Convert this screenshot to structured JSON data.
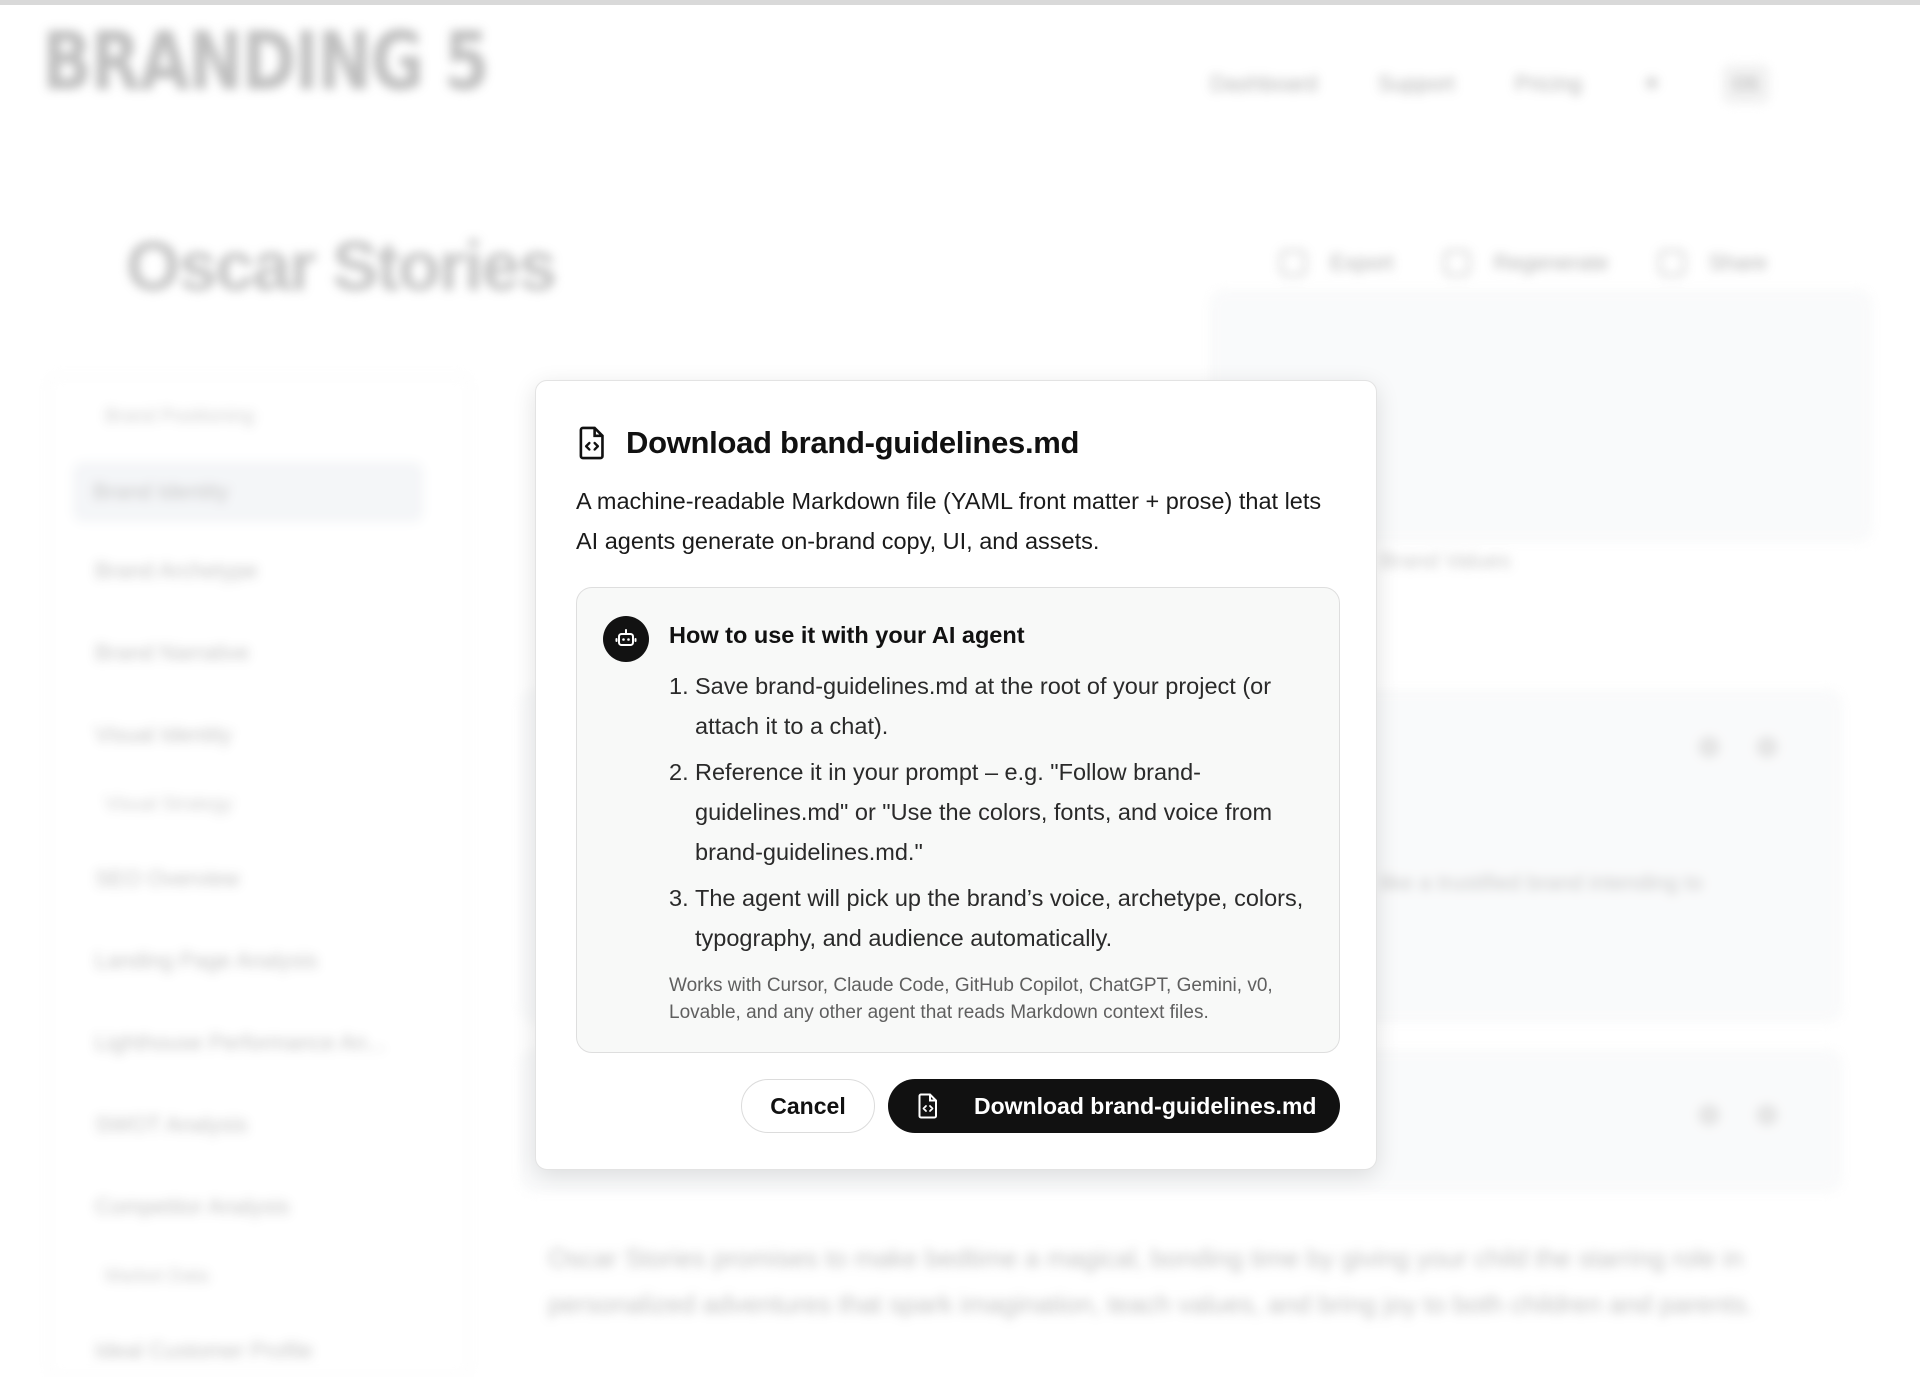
{
  "app": {
    "logo_text": "BRANDING 5",
    "nav": [
      "Dashboard",
      "Support",
      "Pricing"
    ],
    "theme_toggle_icon": "sun-icon",
    "profile_label": "OS"
  },
  "page": {
    "title": "Oscar Stories",
    "actions": [
      "Export",
      "Regenerate",
      "Share"
    ]
  },
  "sidebar": {
    "group_1": "Brand Positioning",
    "items_1": [
      "Brand Identity",
      "Brand Archetype",
      "Brand Narrative",
      "Visual Identity"
    ],
    "group_2": "Visual Strategy",
    "items_2": [
      "SEO Overview",
      "Landing Page Analysis",
      "Lighthouse Performance An...",
      "SWOT Analysis",
      "Competitor Analysis"
    ],
    "group_3": "Market Data",
    "items_3": [
      "Ideal Customer Profile"
    ]
  },
  "background_content": {
    "card_text_1": "Brand Values",
    "card_text_2": "like a trustified brand intending to",
    "paragraph": "Oscar Stories promises to make bedtime a magical, bonding time by giving your child the starring role in personalized adventures that spark imagination, teach values, and bring joy to both children and parents."
  },
  "modal": {
    "title": "Download brand-guidelines.md",
    "title_icon": "file-code-icon",
    "description": "A machine-readable Markdown file (YAML front matter + prose) that lets AI agents generate on-brand copy, UI, and assets.",
    "howto": {
      "icon": "robot-icon",
      "title": "How to use it with your AI agent",
      "steps": [
        {
          "num": "1.",
          "text": "Save brand-guidelines.md at the root of your project (or attach it to a chat)."
        },
        {
          "num": "2.",
          "text": "Reference it in your prompt – e.g. \"Follow brand-guidelines.md\" or \"Use the colors, fonts, and voice from brand-guidelines.md.\""
        },
        {
          "num": "3.",
          "text": "The agent will pick up the brand’s voice, archetype, colors, typography, and audience automatically."
        }
      ],
      "footnote": "Works with Cursor, Claude Code, GitHub Copilot, ChatGPT, Gemini, v0, Lovable, and any other agent that reads Markdown context files."
    },
    "cancel_label": "Cancel",
    "download_label": "Download brand-guidelines.md",
    "download_icon": "file-code-icon"
  },
  "colors": {
    "primary_button": "#111111",
    "modal_background": "#ffffff",
    "panel_background": "#f8f9f8"
  }
}
